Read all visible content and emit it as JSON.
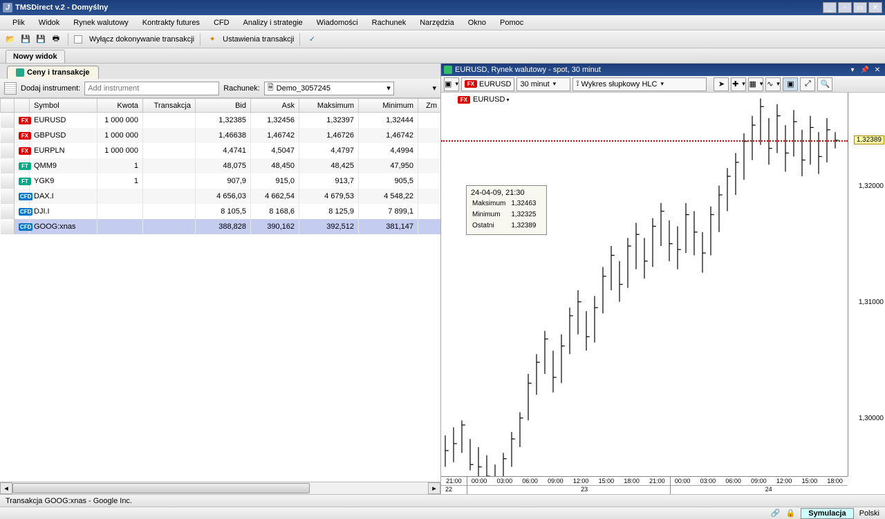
{
  "title": "TMSDirect v.2 - Domyślny",
  "menu": [
    "Plik",
    "Widok",
    "Rynek walutowy",
    "Kontrakty futures",
    "CFD",
    "Analizy i strategie",
    "Wiadomości",
    "Rachunek",
    "Narzędzia",
    "Okno",
    "Pomoc"
  ],
  "toolbar": {
    "checkbox_label": "Wyłącz dokonywanie transakcji",
    "settings_label": "Ustawienia transakcji"
  },
  "tab_main": "Nowy widok",
  "left": {
    "panel_tab": "Ceny i transakcje",
    "add_label": "Dodaj instrument:",
    "add_placeholder": "Add instrument",
    "account_label": "Rachunek:",
    "account_value": "Demo_3057245",
    "columns": [
      "",
      "",
      "Symbol",
      "Kwota",
      "Transakcja",
      "Bid",
      "Ask",
      "Maksimum",
      "Minimum",
      "Zm"
    ],
    "rows": [
      {
        "type": "fx",
        "symbol": "EURUSD",
        "qty": "1 000 000",
        "tx": "",
        "bid": "1,32385",
        "ask": "1,32456",
        "max": "1,32397",
        "min": "1,32444"
      },
      {
        "type": "fx",
        "symbol": "GBPUSD",
        "qty": "1 000 000",
        "tx": "",
        "bid": "1,46638",
        "ask": "1,46742",
        "max": "1,46726",
        "min": "1,46742"
      },
      {
        "type": "fx",
        "symbol": "EURPLN",
        "qty": "1 000 000",
        "tx": "",
        "bid": "4,4741",
        "ask": "4,5047",
        "max": "4,4797",
        "min": "4,4994"
      },
      {
        "type": "ft",
        "symbol": "QMM9",
        "qty": "1",
        "tx": "",
        "bid": "48,075",
        "ask": "48,450",
        "max": "48,425",
        "min": "47,950"
      },
      {
        "type": "ft",
        "symbol": "YGK9",
        "qty": "1",
        "tx": "",
        "bid": "907,9",
        "ask": "915,0",
        "max": "913,7",
        "min": "905,5"
      },
      {
        "type": "cfd",
        "symbol": "DAX.I",
        "qty": "",
        "tx": "",
        "bid": "4 656,03",
        "ask": "4 662,54",
        "max": "4 679,53",
        "min": "4 548,22"
      },
      {
        "type": "cfd",
        "symbol": "DJI.I",
        "qty": "",
        "tx": "",
        "bid": "8 105,5",
        "ask": "8 168,6",
        "max": "8 125,9",
        "min": "7 899,1"
      },
      {
        "type": "cfd",
        "symbol": "GOOG:xnas",
        "qty": "",
        "tx": "",
        "bid": "388,828",
        "ask": "390,162",
        "max": "392,512",
        "min": "381,147",
        "selected": true
      }
    ]
  },
  "chart": {
    "title": "EURUSD, Rynek walutowy - spot, 30 minut",
    "symbol": "EURUSD",
    "interval": "30 minut",
    "chart_type": "Wykres słupkowy HLC",
    "legend": "EURUSD",
    "tooltip": {
      "datetime": "24-04-09, 21:30",
      "max_label": "Maksimum",
      "max": "1,32463",
      "min_label": "Minimum",
      "min": "1,32325",
      "last_label": "Ostatni",
      "last": "1,32389"
    },
    "current_price": "1,32389",
    "yticks": [
      "1,32000",
      "1,31000",
      "1,30000"
    ],
    "xtimes": [
      "21:00",
      "00:00",
      "03:00",
      "06:00",
      "09:00",
      "12:00",
      "15:00",
      "18:00",
      "21:00",
      "00:00",
      "03:00",
      "06:00",
      "09:00",
      "12:00",
      "15:00",
      "18:00"
    ],
    "xdays": [
      "22",
      "23",
      "24"
    ]
  },
  "status": {
    "left": "Transakcja GOOG:xnas - Google Inc.",
    "sim": "Symulacja",
    "lang": "Polski"
  },
  "chart_data": {
    "type": "ohlc_hlc",
    "interval_minutes": 30,
    "ylim": [
      1.295,
      1.328
    ],
    "current": 1.32389,
    "bars": [
      {
        "h": 1.2985,
        "l": 1.2958,
        "c": 1.2972
      },
      {
        "h": 1.2992,
        "l": 1.2962,
        "c": 1.2978
      },
      {
        "h": 1.2998,
        "l": 1.297,
        "c": 1.2994
      },
      {
        "h": 1.2982,
        "l": 1.2955,
        "c": 1.296
      },
      {
        "h": 1.2975,
        "l": 1.2948,
        "c": 1.2958
      },
      {
        "h": 1.2968,
        "l": 1.294,
        "c": 1.295
      },
      {
        "h": 1.296,
        "l": 1.2932,
        "c": 1.2938
      },
      {
        "h": 1.297,
        "l": 1.2935,
        "c": 1.2965
      },
      {
        "h": 1.2988,
        "l": 1.2958,
        "c": 1.2982
      },
      {
        "h": 1.3005,
        "l": 1.2975,
        "c": 1.3
      },
      {
        "h": 1.3038,
        "l": 1.2998,
        "c": 1.303
      },
      {
        "h": 1.3055,
        "l": 1.302,
        "c": 1.3048
      },
      {
        "h": 1.3075,
        "l": 1.3038,
        "c": 1.3068
      },
      {
        "h": 1.3058,
        "l": 1.3022,
        "c": 1.3035
      },
      {
        "h": 1.3072,
        "l": 1.303,
        "c": 1.3062
      },
      {
        "h": 1.3095,
        "l": 1.3055,
        "c": 1.3088
      },
      {
        "h": 1.311,
        "l": 1.3072,
        "c": 1.31
      },
      {
        "h": 1.3092,
        "l": 1.3058,
        "c": 1.307
      },
      {
        "h": 1.3105,
        "l": 1.3065,
        "c": 1.3095
      },
      {
        "h": 1.313,
        "l": 1.309,
        "c": 1.3122
      },
      {
        "h": 1.3148,
        "l": 1.311,
        "c": 1.314
      },
      {
        "h": 1.3135,
        "l": 1.31,
        "c": 1.3115
      },
      {
        "h": 1.3155,
        "l": 1.3112,
        "c": 1.3148
      },
      {
        "h": 1.3168,
        "l": 1.3128,
        "c": 1.3158
      },
      {
        "h": 1.3155,
        "l": 1.312,
        "c": 1.3135
      },
      {
        "h": 1.3172,
        "l": 1.313,
        "c": 1.3165
      },
      {
        "h": 1.3185,
        "l": 1.3148,
        "c": 1.3178
      },
      {
        "h": 1.317,
        "l": 1.3135,
        "c": 1.315
      },
      {
        "h": 1.3165,
        "l": 1.3128,
        "c": 1.3145
      },
      {
        "h": 1.3185,
        "l": 1.3142,
        "c": 1.3175
      },
      {
        "h": 1.3178,
        "l": 1.314,
        "c": 1.316
      },
      {
        "h": 1.316,
        "l": 1.3125,
        "c": 1.3142
      },
      {
        "h": 1.3182,
        "l": 1.314,
        "c": 1.3175
      },
      {
        "h": 1.32,
        "l": 1.316,
        "c": 1.3192
      },
      {
        "h": 1.3215,
        "l": 1.3178,
        "c": 1.3208
      },
      {
        "h": 1.3228,
        "l": 1.3192,
        "c": 1.322
      },
      {
        "h": 1.3245,
        "l": 1.3205,
        "c": 1.3238
      },
      {
        "h": 1.326,
        "l": 1.3222,
        "c": 1.3252
      },
      {
        "h": 1.3275,
        "l": 1.3235,
        "c": 1.3268
      },
      {
        "h": 1.3258,
        "l": 1.3218,
        "c": 1.3232
      },
      {
        "h": 1.327,
        "l": 1.3228,
        "c": 1.326
      },
      {
        "h": 1.3252,
        "l": 1.3212,
        "c": 1.3228
      },
      {
        "h": 1.3265,
        "l": 1.3225,
        "c": 1.3255
      },
      {
        "h": 1.3248,
        "l": 1.3208,
        "c": 1.3222
      },
      {
        "h": 1.326,
        "l": 1.3218,
        "c": 1.325
      },
      {
        "h": 1.3246,
        "l": 1.321,
        "c": 1.3225
      },
      {
        "h": 1.3258,
        "l": 1.322,
        "c": 1.3248
      },
      {
        "h": 1.3246,
        "l": 1.3232,
        "c": 1.3239
      }
    ]
  }
}
